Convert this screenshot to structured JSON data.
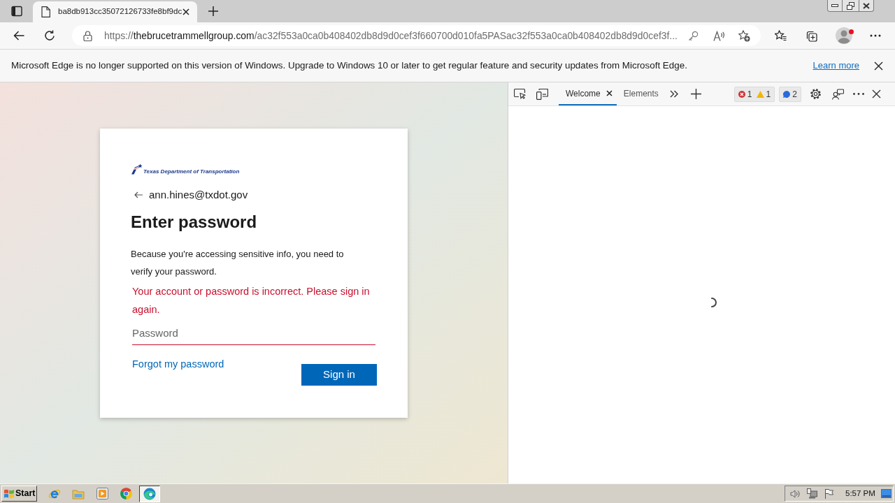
{
  "browser": {
    "tabs": [
      {
        "title": "ba8db913cc35072126733fe8bf9dc",
        "selected": true
      }
    ],
    "address_bar": {
      "scheme": "https://",
      "host": "thebrucetrammellgroup.com",
      "path": "/ac32f553a0ca0b408402db8d9d0cef3f660700d010fa5PASac32f553a0ca0b408402db8d9d0cef3f..."
    },
    "infobar": {
      "message": "Microsoft Edge is no longer supported on this version of Windows. Upgrade to Windows 10 or later to get regular feature and security updates from Microsoft Edge.",
      "link": "Learn more"
    }
  },
  "sign_in": {
    "logo_text": "Texas Department of Transportation",
    "account": "ann.hines@txdot.gov",
    "heading": "Enter password",
    "description": "Because you're accessing sensitive info, you need to verify your password.",
    "error": "Your account or password is incorrect. Please sign in again.",
    "password_field": {
      "placeholder": "Password",
      "invalid": true
    },
    "forgot_link": "Forgot my password",
    "submit_button": "Sign in"
  },
  "devtools": {
    "tabs": [
      {
        "label": "Welcome",
        "selected": true,
        "closable": true
      },
      {
        "label": "Elements",
        "selected": false,
        "closable": false
      }
    ],
    "counter_groups": [
      {
        "counts": [
          {
            "kind": "error",
            "count": "1"
          },
          {
            "kind": "warning",
            "count": "1"
          }
        ]
      },
      {
        "counts": [
          {
            "kind": "info",
            "count": "2"
          }
        ]
      }
    ]
  },
  "taskbar": {
    "start_label": "Start",
    "apps": [
      {
        "kind": "ie",
        "selected": false
      },
      {
        "kind": "folder",
        "selected": false
      },
      {
        "kind": "media",
        "selected": false
      },
      {
        "kind": "chrome",
        "selected": false
      },
      {
        "kind": "edge",
        "selected": true
      }
    ],
    "clock": "5:57 PM"
  }
}
